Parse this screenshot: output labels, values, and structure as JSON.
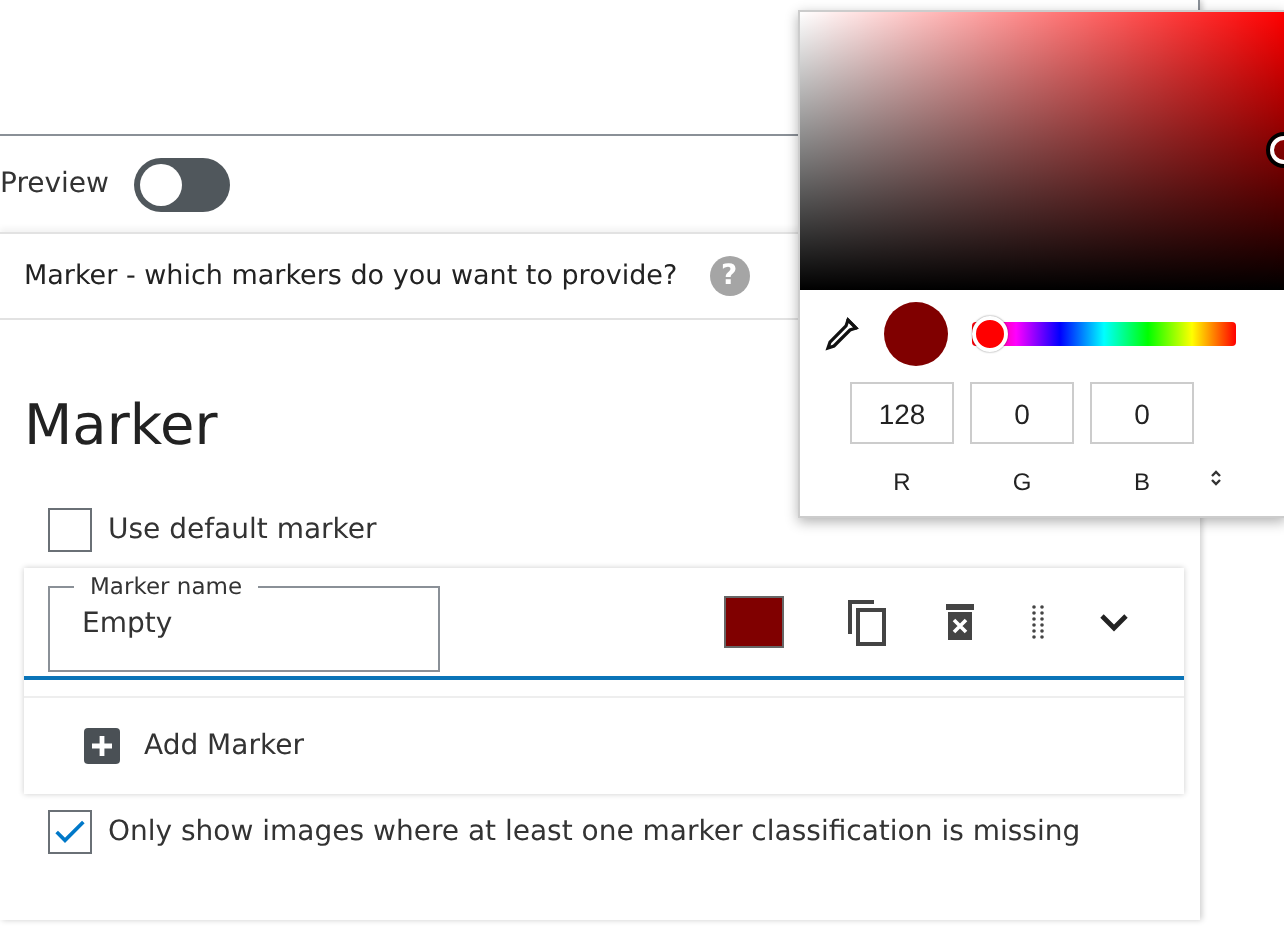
{
  "preview": {
    "label": "Preview",
    "on": false
  },
  "section": {
    "title": "Marker - which markers do you want to provide?",
    "help": "?"
  },
  "heading": "Marker",
  "use_default": {
    "label": "Use default marker",
    "checked": false
  },
  "marker": {
    "field_label": "Marker name",
    "value": "Empty",
    "color": "#800000"
  },
  "add_button": "Add Marker",
  "only_missing": {
    "label": "Only show images where at least one marker classification is missing",
    "checked": true
  },
  "color_picker": {
    "hue": {
      "level": 0
    },
    "channels": [
      {
        "label": "R",
        "value": "128"
      },
      {
        "label": "G",
        "value": "0"
      },
      {
        "label": "B",
        "value": "0"
      }
    ]
  }
}
